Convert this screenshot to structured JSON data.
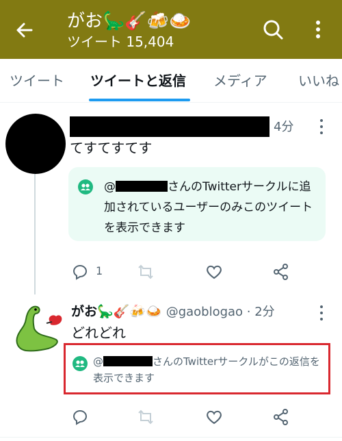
{
  "header": {
    "title": "がお🦕🎸🍻🍛",
    "subtitle": "ツイート 15,404",
    "back_icon": "arrow-left-icon",
    "search_icon": "search-icon",
    "more_icon": "more-vertical-icon",
    "bg_color": "#827a12"
  },
  "tabs": [
    {
      "label": "ツイート",
      "active": false
    },
    {
      "label": "ツイートと返信",
      "active": true
    },
    {
      "label": "メディア",
      "active": false
    },
    {
      "label": "いいね",
      "active": false
    }
  ],
  "tweet1": {
    "time": "4分",
    "text": "てすてすてす",
    "circle_notice_prefix": "@",
    "circle_notice": "さんのTwitterサークルに追加されているユーザーのみこのツイートを表示できます",
    "reply_count": "1"
  },
  "tweet2": {
    "name": "がお🦕🎸🍻🍛",
    "handle": "@gaoblogao · 2分",
    "text": "どれどれ",
    "circle_notice_prefix": "@",
    "circle_notice": "さんのTwitterサークルがこの返信を表示できます"
  },
  "colors": {
    "accent": "#1d9bf0",
    "circle_green": "#20b981",
    "highlight_red": "#d9282f"
  }
}
